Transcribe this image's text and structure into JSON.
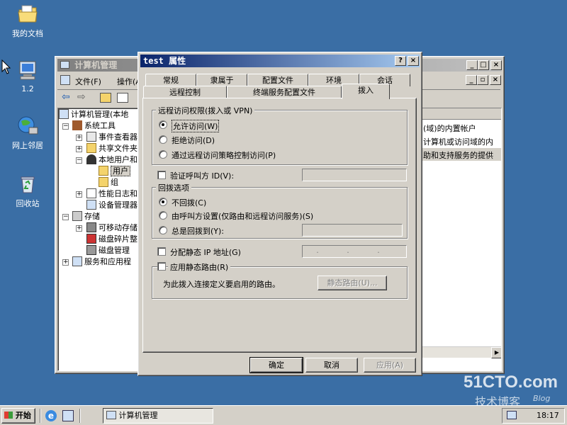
{
  "desktop": {
    "icons": [
      {
        "label": "我的文档"
      },
      {
        "label": "1.2"
      },
      {
        "label": "网上邻居"
      },
      {
        "label": "回收站"
      }
    ]
  },
  "mmc": {
    "title": "计算机管理",
    "menu": [
      "文件(F)",
      "操作(A)"
    ],
    "tree": [
      {
        "label": "计算机管理(本地"
      },
      {
        "label": "系统工具"
      },
      {
        "label": "事件查看器"
      },
      {
        "label": "共享文件夹"
      },
      {
        "label": "本地用户和"
      },
      {
        "label": "用户"
      },
      {
        "label": "组"
      },
      {
        "label": "性能日志和"
      },
      {
        "label": "设备管理器"
      },
      {
        "label": "存储"
      },
      {
        "label": "可移动存储"
      },
      {
        "label": "磁盘碎片整"
      },
      {
        "label": "磁盘管理"
      },
      {
        "label": "服务和应用程"
      }
    ],
    "desc_lines": [
      "(域)的内置帐户",
      "计算机或访问域的内",
      "助和支持服务的提供"
    ]
  },
  "dialog": {
    "title": "test 属性",
    "tabs_back": [
      "常规",
      "隶属于",
      "配置文件",
      "环境",
      "会话"
    ],
    "tabs_front": [
      "远程控制",
      "终端服务配置文件",
      "拨入"
    ],
    "remote_access": {
      "label": "远程访问权限(拨入或 VPN)",
      "options": [
        "允许访问(W)",
        "拒绝访问(D)",
        "通过远程访问策略控制访问(P)"
      ],
      "selected": 0
    },
    "verify_caller": "验证呼叫方 ID(V):",
    "callback": {
      "label": "回拨选项",
      "options": [
        "不回拨(C)",
        "由呼叫方设置(仅路由和远程访问服务)(S)",
        "总是回拨到(Y):"
      ],
      "selected": 0
    },
    "static_ip": "分配静态 IP 地址(G)",
    "ip_placeholder": ". . .",
    "static_route": "应用静态路由(R)",
    "route_desc": "为此拨入连接定义要启用的路由。",
    "route_button": "静态路由(U)...",
    "buttons": {
      "ok": "确定",
      "cancel": "取消",
      "apply": "应用(A)"
    }
  },
  "taskbar": {
    "start": "开始",
    "task": "计算机管理",
    "clock": "18:17"
  },
  "watermark": {
    "site": "51CTO.com",
    "sub": "技术博客",
    "blog": "Blog"
  }
}
